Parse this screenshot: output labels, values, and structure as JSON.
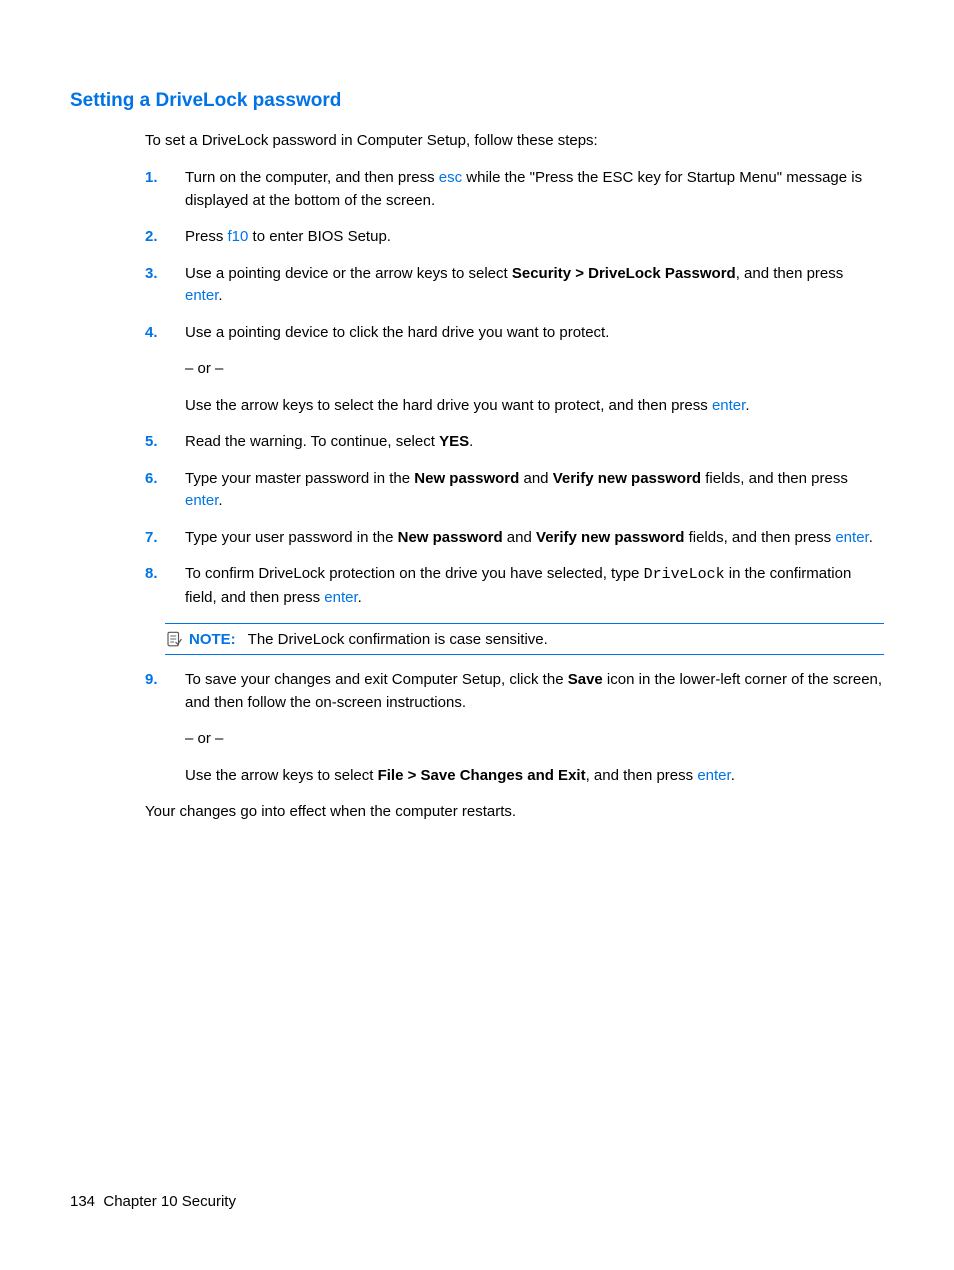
{
  "heading": "Setting a DriveLock password",
  "intro": "To set a DriveLock password in Computer Setup, follow these steps:",
  "steps": {
    "s1": {
      "num": "1.",
      "t1": "Turn on the computer, and then press ",
      "key1": "esc",
      "t2": " while the \"Press the ESC key for Startup Menu\" message is displayed at the bottom of the screen."
    },
    "s2": {
      "num": "2.",
      "t1": "Press ",
      "key1": "f10",
      "t2": " to enter BIOS Setup."
    },
    "s3": {
      "num": "3.",
      "t1": "Use a pointing device or the arrow keys to select ",
      "bold1": "Security > DriveLock Password",
      "t2": ", and then press ",
      "key1": "enter",
      "t3": "."
    },
    "s4": {
      "num": "4.",
      "p1": "Use a pointing device to click the hard drive you want to protect.",
      "p2": "– or –",
      "p3a": "Use the arrow keys to select the hard drive you want to protect, and then press ",
      "p3key": "enter",
      "p3b": "."
    },
    "s5": {
      "num": "5.",
      "t1": "Read the warning. To continue, select ",
      "bold1": "YES",
      "t2": "."
    },
    "s6": {
      "num": "6.",
      "t1": "Type your master password in the ",
      "bold1": "New password",
      "t2": " and ",
      "bold2": "Verify new password",
      "t3": " fields, and then press ",
      "key1": "enter",
      "t4": "."
    },
    "s7": {
      "num": "7.",
      "t1": "Type your user password in the ",
      "bold1": "New password",
      "t2": " and ",
      "bold2": "Verify new password",
      "t3": " fields, and then press ",
      "key1": "enter",
      "t4": "."
    },
    "s8": {
      "num": "8.",
      "t1": "To confirm DriveLock protection on the drive you have selected, type ",
      "mono1": "DriveLock",
      "t2": " in the confirmation field, and then press ",
      "key1": "enter",
      "t3": "."
    },
    "s9": {
      "num": "9.",
      "p1a": "To save your changes and exit Computer Setup, click the ",
      "p1bold": "Save",
      "p1b": " icon in the lower-left corner of the screen, and then follow the on-screen instructions.",
      "p2": "– or –",
      "p3a": "Use the arrow keys to select ",
      "p3bold": "File > Save Changes and Exit",
      "p3b": ", and then press ",
      "p3key": "enter",
      "p3c": "."
    }
  },
  "note": {
    "label": "NOTE:",
    "text": "The DriveLock confirmation is case sensitive."
  },
  "closing": "Your changes go into effect when the computer restarts.",
  "footer": {
    "page": "134",
    "chapter": "Chapter 10   Security"
  }
}
